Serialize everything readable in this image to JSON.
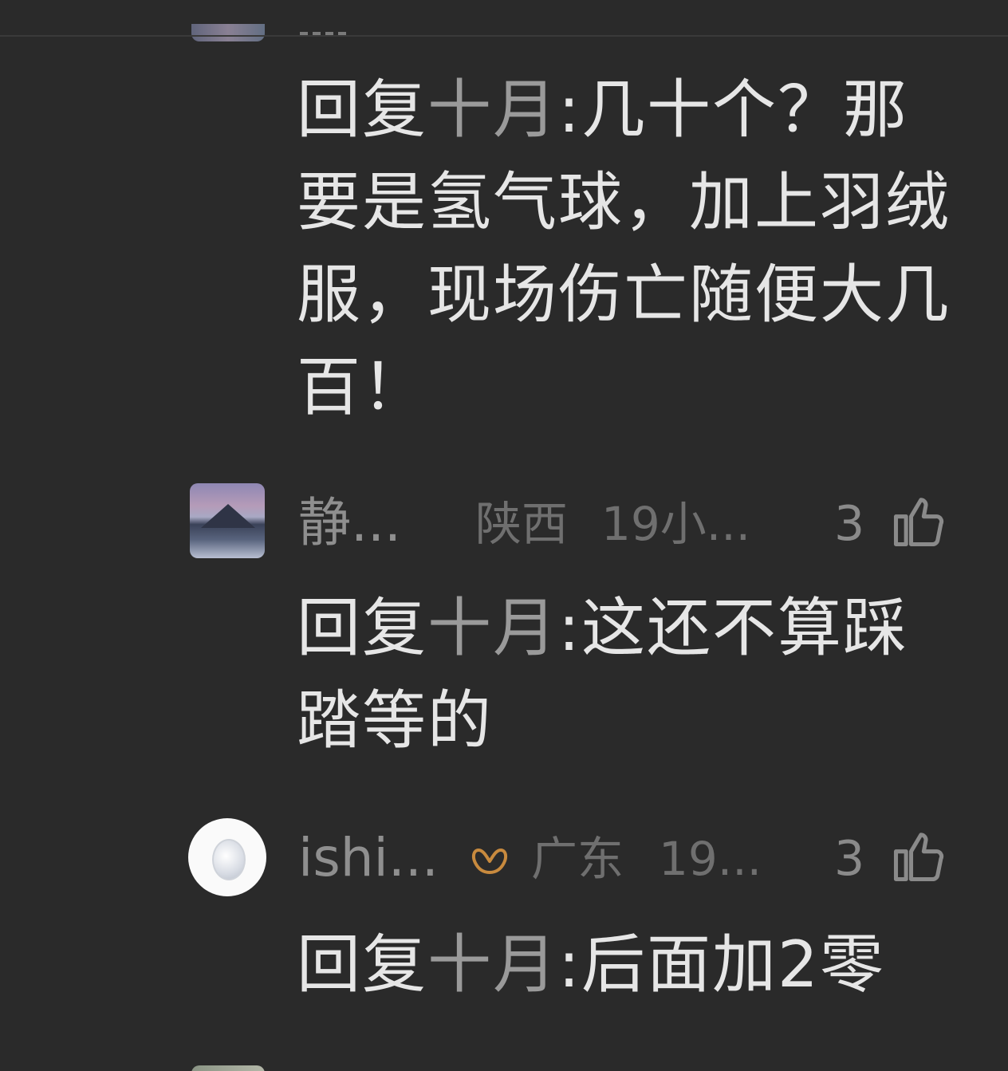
{
  "comments": [
    {
      "reply_prefix": "回复",
      "reply_target": "十月",
      "reply_body": ":几十个？那要是氢气球，加上羽绒服，现场伤亡随便大几百！"
    },
    {
      "username": "静...",
      "location": "陕西",
      "time": "19小...",
      "likes": "3",
      "reply_prefix": "回复",
      "reply_target": "十月",
      "reply_body": ":这还不算踩踏等的"
    },
    {
      "username": "ishi...",
      "location": "广东",
      "time": "19...",
      "likes": "3",
      "reply_prefix": "回复",
      "reply_target": "十月",
      "reply_body": ":后面加2零"
    }
  ],
  "colors": {
    "background": "#2a2a2a",
    "text_primary": "#e6e6e6",
    "text_reply_target": "#9a9a9a",
    "text_meta": "#6f6f6f",
    "badge": "#c88a3e"
  },
  "icons": {
    "like": "thumbs-up-icon",
    "badge": "infinity-badge-icon"
  }
}
